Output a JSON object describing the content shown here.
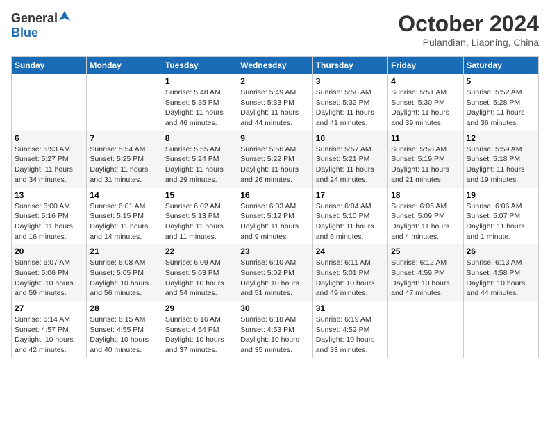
{
  "header": {
    "logo_general": "General",
    "logo_blue": "Blue",
    "month_title": "October 2024",
    "location": "Pulandian, Liaoning, China"
  },
  "weekdays": [
    "Sunday",
    "Monday",
    "Tuesday",
    "Wednesday",
    "Thursday",
    "Friday",
    "Saturday"
  ],
  "weeks": [
    [
      {
        "day": null,
        "info": null
      },
      {
        "day": null,
        "info": null
      },
      {
        "day": "1",
        "sunrise": "5:48 AM",
        "sunset": "5:35 PM",
        "daylight": "11 hours and 46 minutes."
      },
      {
        "day": "2",
        "sunrise": "5:49 AM",
        "sunset": "5:33 PM",
        "daylight": "11 hours and 44 minutes."
      },
      {
        "day": "3",
        "sunrise": "5:50 AM",
        "sunset": "5:32 PM",
        "daylight": "11 hours and 41 minutes."
      },
      {
        "day": "4",
        "sunrise": "5:51 AM",
        "sunset": "5:30 PM",
        "daylight": "11 hours and 39 minutes."
      },
      {
        "day": "5",
        "sunrise": "5:52 AM",
        "sunset": "5:28 PM",
        "daylight": "11 hours and 36 minutes."
      }
    ],
    [
      {
        "day": "6",
        "sunrise": "5:53 AM",
        "sunset": "5:27 PM",
        "daylight": "11 hours and 34 minutes."
      },
      {
        "day": "7",
        "sunrise": "5:54 AM",
        "sunset": "5:25 PM",
        "daylight": "11 hours and 31 minutes."
      },
      {
        "day": "8",
        "sunrise": "5:55 AM",
        "sunset": "5:24 PM",
        "daylight": "11 hours and 29 minutes."
      },
      {
        "day": "9",
        "sunrise": "5:56 AM",
        "sunset": "5:22 PM",
        "daylight": "11 hours and 26 minutes."
      },
      {
        "day": "10",
        "sunrise": "5:57 AM",
        "sunset": "5:21 PM",
        "daylight": "11 hours and 24 minutes."
      },
      {
        "day": "11",
        "sunrise": "5:58 AM",
        "sunset": "5:19 PM",
        "daylight": "11 hours and 21 minutes."
      },
      {
        "day": "12",
        "sunrise": "5:59 AM",
        "sunset": "5:18 PM",
        "daylight": "11 hours and 19 minutes."
      }
    ],
    [
      {
        "day": "13",
        "sunrise": "6:00 AM",
        "sunset": "5:16 PM",
        "daylight": "11 hours and 16 minutes."
      },
      {
        "day": "14",
        "sunrise": "6:01 AM",
        "sunset": "5:15 PM",
        "daylight": "11 hours and 14 minutes."
      },
      {
        "day": "15",
        "sunrise": "6:02 AM",
        "sunset": "5:13 PM",
        "daylight": "11 hours and 11 minutes."
      },
      {
        "day": "16",
        "sunrise": "6:03 AM",
        "sunset": "5:12 PM",
        "daylight": "11 hours and 9 minutes."
      },
      {
        "day": "17",
        "sunrise": "6:04 AM",
        "sunset": "5:10 PM",
        "daylight": "11 hours and 6 minutes."
      },
      {
        "day": "18",
        "sunrise": "6:05 AM",
        "sunset": "5:09 PM",
        "daylight": "11 hours and 4 minutes."
      },
      {
        "day": "19",
        "sunrise": "6:06 AM",
        "sunset": "5:07 PM",
        "daylight": "11 hours and 1 minute."
      }
    ],
    [
      {
        "day": "20",
        "sunrise": "6:07 AM",
        "sunset": "5:06 PM",
        "daylight": "10 hours and 59 minutes."
      },
      {
        "day": "21",
        "sunrise": "6:08 AM",
        "sunset": "5:05 PM",
        "daylight": "10 hours and 56 minutes."
      },
      {
        "day": "22",
        "sunrise": "6:09 AM",
        "sunset": "5:03 PM",
        "daylight": "10 hours and 54 minutes."
      },
      {
        "day": "23",
        "sunrise": "6:10 AM",
        "sunset": "5:02 PM",
        "daylight": "10 hours and 51 minutes."
      },
      {
        "day": "24",
        "sunrise": "6:11 AM",
        "sunset": "5:01 PM",
        "daylight": "10 hours and 49 minutes."
      },
      {
        "day": "25",
        "sunrise": "6:12 AM",
        "sunset": "4:59 PM",
        "daylight": "10 hours and 47 minutes."
      },
      {
        "day": "26",
        "sunrise": "6:13 AM",
        "sunset": "4:58 PM",
        "daylight": "10 hours and 44 minutes."
      }
    ],
    [
      {
        "day": "27",
        "sunrise": "6:14 AM",
        "sunset": "4:57 PM",
        "daylight": "10 hours and 42 minutes."
      },
      {
        "day": "28",
        "sunrise": "6:15 AM",
        "sunset": "4:55 PM",
        "daylight": "10 hours and 40 minutes."
      },
      {
        "day": "29",
        "sunrise": "6:16 AM",
        "sunset": "4:54 PM",
        "daylight": "10 hours and 37 minutes."
      },
      {
        "day": "30",
        "sunrise": "6:18 AM",
        "sunset": "4:53 PM",
        "daylight": "10 hours and 35 minutes."
      },
      {
        "day": "31",
        "sunrise": "6:19 AM",
        "sunset": "4:52 PM",
        "daylight": "10 hours and 33 minutes."
      },
      {
        "day": null,
        "info": null
      },
      {
        "day": null,
        "info": null
      }
    ]
  ]
}
